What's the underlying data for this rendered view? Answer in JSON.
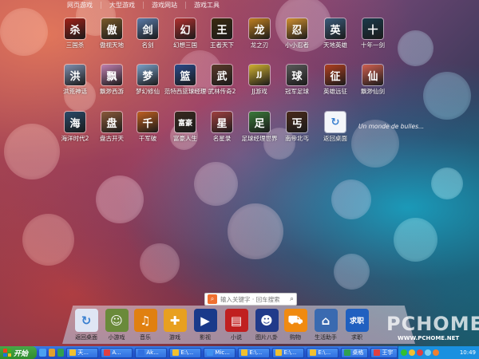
{
  "tabs": [
    {
      "label": "网页游戏",
      "active": true
    },
    {
      "label": "大型游戏",
      "active": false
    },
    {
      "label": "游戏网站",
      "active": false
    },
    {
      "label": "游戏工具",
      "active": false
    }
  ],
  "apps": [
    {
      "label": "三国杀",
      "glyph": "杀",
      "color": "#a02018"
    },
    {
      "label": "傲视天地",
      "glyph": "傲",
      "color": "#7a5a2a"
    },
    {
      "label": "名剑",
      "glyph": "剑",
      "color": "#5a7aa8"
    },
    {
      "label": "幻想三国",
      "glyph": "幻",
      "color": "#b03030"
    },
    {
      "label": "王者天下",
      "glyph": "王",
      "color": "#3a2a10"
    },
    {
      "label": "龙之刃",
      "glyph": "龙",
      "color": "#c08020"
    },
    {
      "label": "小小忍者",
      "glyph": "忍",
      "color": "#d09030"
    },
    {
      "label": "天地英雄",
      "glyph": "英",
      "color": "#3a5a7a"
    },
    {
      "label": "十年一剑",
      "glyph": "十",
      "color": "#1a3a4a"
    },
    {
      "label": "洪荒神话",
      "glyph": "洪",
      "color": "#8090b0"
    },
    {
      "label": "飘渺西游",
      "glyph": "飘",
      "color": "#c080b0"
    },
    {
      "label": "梦幻修仙",
      "glyph": "梦",
      "color": "#7aa0c8"
    },
    {
      "label": "范特西篮球经理",
      "glyph": "篮",
      "color": "#2a4a8a"
    },
    {
      "label": "武林传奇2",
      "glyph": "武",
      "color": "#5a3a2a"
    },
    {
      "label": "JJ游戏",
      "glyph": "JJ",
      "color": "#d0b030"
    },
    {
      "label": "冠军足球",
      "glyph": "球",
      "color": "#5a5a5a"
    },
    {
      "label": "英雄远征",
      "glyph": "征",
      "color": "#b04020"
    },
    {
      "label": "飘渺仙剑",
      "glyph": "仙",
      "color": "#d06050"
    },
    {
      "label": "海洋时代2",
      "glyph": "海",
      "color": "#2a4a6a"
    },
    {
      "label": "盘古开天",
      "glyph": "盘",
      "color": "#8a5a3a"
    },
    {
      "label": "千军破",
      "glyph": "千",
      "color": "#c06020"
    },
    {
      "label": "富豪人生",
      "glyph": "富豪",
      "color": "#3a2a20"
    },
    {
      "label": "名星录",
      "glyph": "星",
      "color": "#a04040"
    },
    {
      "label": "足球经理世界",
      "glyph": "足",
      "color": "#3a7a3a"
    },
    {
      "label": "南帝北丐",
      "glyph": "丐",
      "color": "#4a2a1a"
    },
    {
      "label": "返回桌面",
      "glyph": "↻",
      "color": "#e8eef8"
    }
  ],
  "ad_text": "Un monde de bulles...",
  "search": {
    "placeholder": "输入关键字 · 回车搜索"
  },
  "dock": [
    {
      "label": "返回桌面",
      "glyph": "↻",
      "color": "#dfe6f4"
    },
    {
      "label": "小游戏",
      "glyph": "☺",
      "color": "#6a8a3a"
    },
    {
      "label": "音乐",
      "glyph": "♫",
      "color": "#e08010"
    },
    {
      "label": "游戏",
      "glyph": "✚",
      "color": "#e8a020"
    },
    {
      "label": "影视",
      "glyph": "▶",
      "color": "#1a3a8a"
    },
    {
      "label": "小说",
      "glyph": "▤",
      "color": "#c02020"
    },
    {
      "label": "图片八卦",
      "glyph": "☻",
      "color": "#203a8a"
    },
    {
      "label": "购物",
      "glyph": "⛟",
      "color": "#f08a10"
    },
    {
      "label": "生活助手",
      "glyph": "⌂",
      "color": "#3a6ab0"
    },
    {
      "label": "求职",
      "glyph": "求职",
      "color": "#2060c0"
    }
  ],
  "watermark": {
    "big": "PCHOME",
    "small": "WWW.PCHOME.NET"
  },
  "taskbar": {
    "start": "开始",
    "buttons": [
      "天...",
      "A...",
      "Ak...",
      "E:\\...",
      "Mic...",
      "E:\\...",
      "E:\\...",
      "E:\\...",
      "桌格",
      "王宇"
    ],
    "clock": "10:49"
  }
}
